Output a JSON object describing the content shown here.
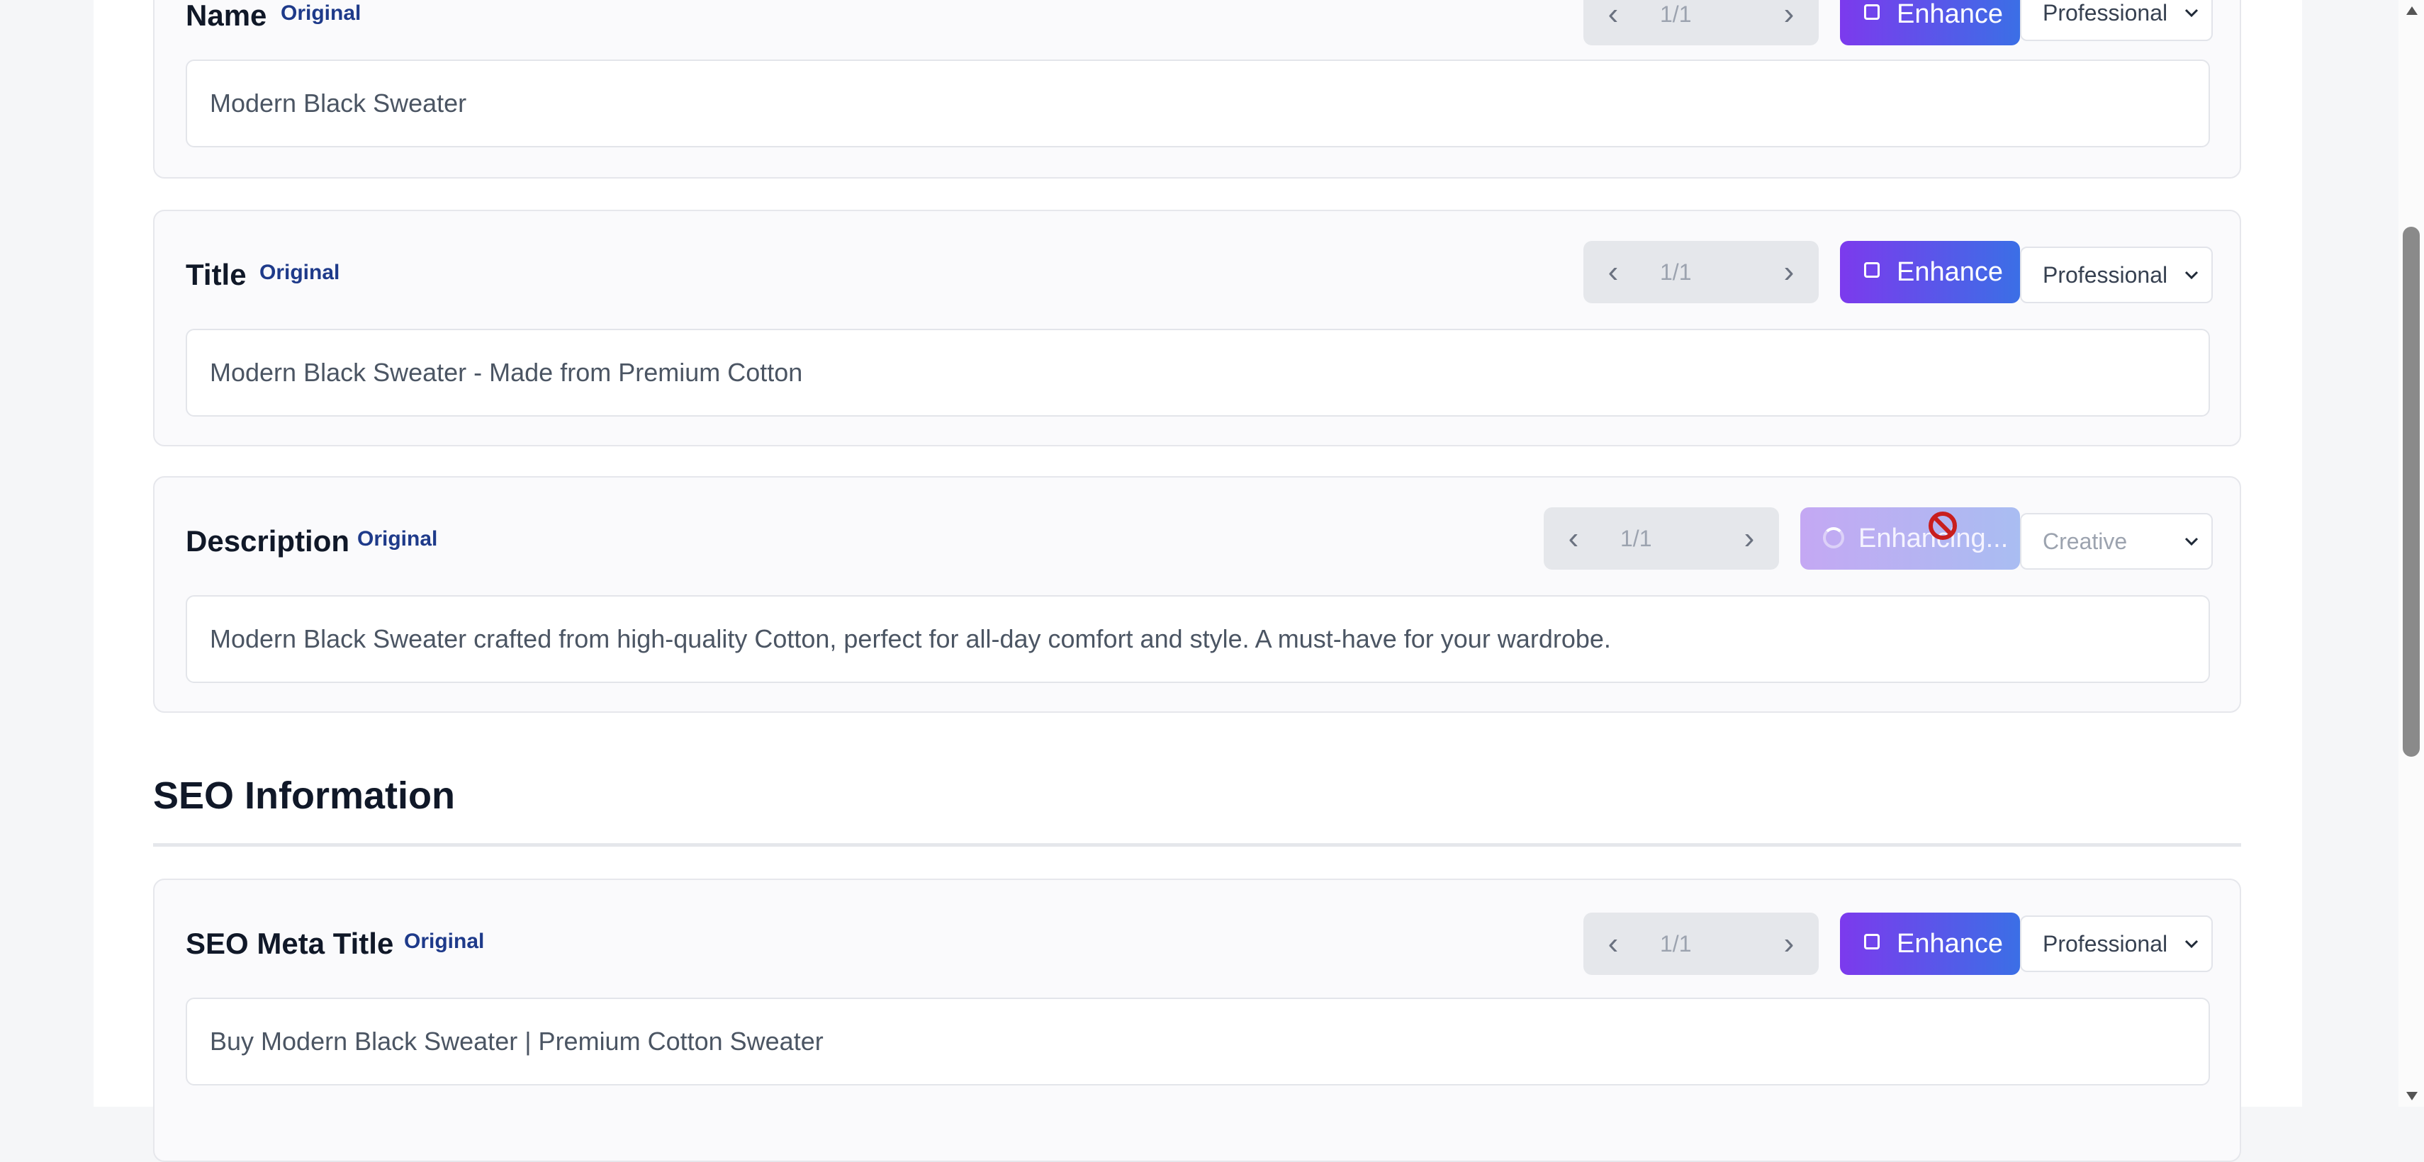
{
  "fields": [
    {
      "label": "Name",
      "badge": "Original",
      "pager": {
        "prev": "‹",
        "count": "1/1",
        "next": "›"
      },
      "enhance_label": "Enhance",
      "tone": "Professional",
      "value": "Modern Black Sweater"
    },
    {
      "label": "Title",
      "badge": "Original",
      "pager": {
        "prev": "‹",
        "count": "1/1",
        "next": "›"
      },
      "enhance_label": "Enhance",
      "tone": "Professional",
      "value": "Modern Black Sweater - Made from Premium Cotton"
    },
    {
      "label": "Description",
      "badge": "Original",
      "pager": {
        "prev": "‹",
        "count": "1/1",
        "next": "›"
      },
      "enhance_label": "Enhancing...",
      "enhance_state": "loading",
      "tone": "Creative",
      "tone_state": "disabled",
      "value": "Modern Black Sweater crafted from high-quality Cotton, perfect for all-day comfort and style. A must-have for your wardrobe."
    }
  ],
  "seo_section": {
    "title": "SEO Information",
    "fields": [
      {
        "label": "SEO Meta Title",
        "badge": "Original",
        "pager": {
          "prev": "‹",
          "count": "1/1",
          "next": "›"
        },
        "enhance_label": "Enhance",
        "tone": "Professional",
        "value": "Buy Modern Black Sweater | Premium Cotton Sweater"
      }
    ]
  },
  "cursor": {
    "icon": "not-allowed-cursor-icon"
  },
  "colors": {
    "accent_start": "#7c3aed",
    "accent_end": "#3b6fe6",
    "badge": "#1e3a8a",
    "card_bg": "#fafafc"
  }
}
